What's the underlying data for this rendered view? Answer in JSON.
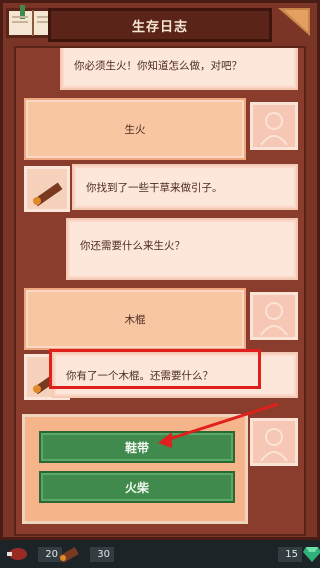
{
  "header": {
    "title": "生存日志"
  },
  "messages": [
    {
      "role": "npc",
      "text": "你必须生火！你知道怎么做，对吧？"
    },
    {
      "role": "player",
      "text": "生火"
    },
    {
      "role": "npc",
      "text": "你找到了一些干草来做引子。",
      "icon": "stick-icon"
    },
    {
      "role": "npc",
      "text": "你还需要什么来生火？"
    },
    {
      "role": "player",
      "text": "木棍"
    },
    {
      "role": "npc",
      "text": "你有了一个木棍。还需要什么？",
      "icon": "stick-icon"
    }
  ],
  "choices": [
    {
      "label": "鞋带"
    },
    {
      "label": "火柴"
    }
  ],
  "resources": [
    {
      "name": "meat",
      "icon": "meat-icon",
      "count": "20"
    },
    {
      "name": "wood",
      "icon": "log-icon",
      "count": "30"
    },
    {
      "name": "gem",
      "icon": "gem-icon",
      "count": "15"
    }
  ],
  "colors": {
    "frame": "#7a3526",
    "npc_bubble": "#fde7da",
    "player_bubble": "#f8c7a1",
    "choice_button": "#3f8a4c",
    "highlight": "#e0201c"
  }
}
